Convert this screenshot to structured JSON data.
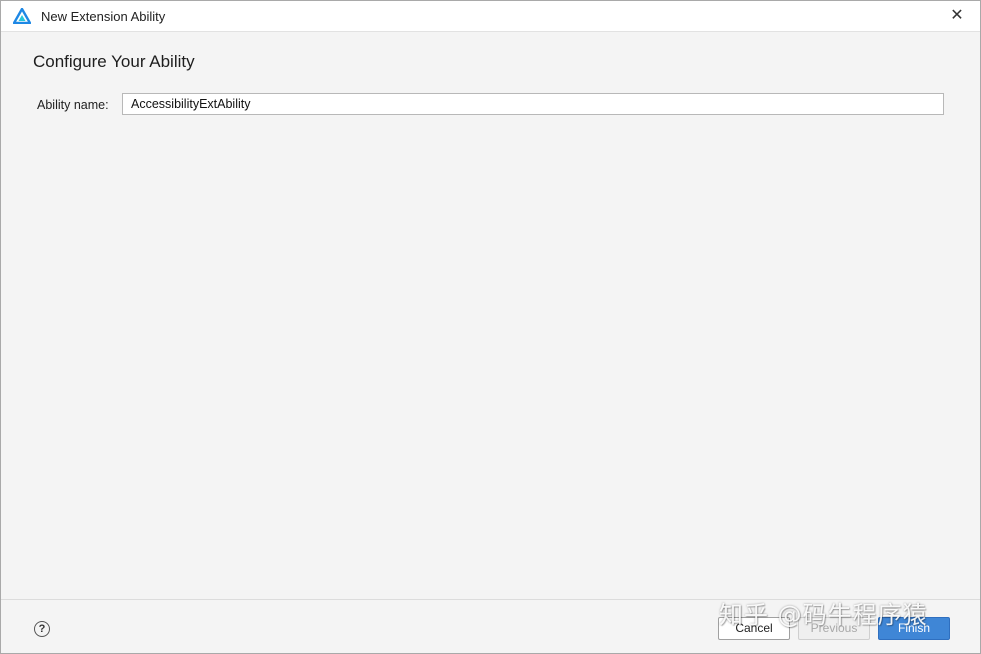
{
  "window": {
    "title": "New Extension Ability",
    "app_icon": "deveco-logo-icon",
    "close_icon": "close-icon",
    "close_glyph": "✕"
  },
  "main": {
    "heading": "Configure Your Ability",
    "ability_name_label": "Ability name:",
    "ability_name_value": "AccessibilityExtAbility"
  },
  "footer": {
    "help_icon": "help-icon",
    "help_glyph": "?",
    "cancel_label": "Cancel",
    "previous_label": "Previous",
    "finish_label": "Finish"
  },
  "watermark": {
    "text": "知乎 @码牛程序猿"
  },
  "colors": {
    "accent": "#3f86d6",
    "background": "#f4f4f4",
    "titlebar": "#ffffff"
  }
}
